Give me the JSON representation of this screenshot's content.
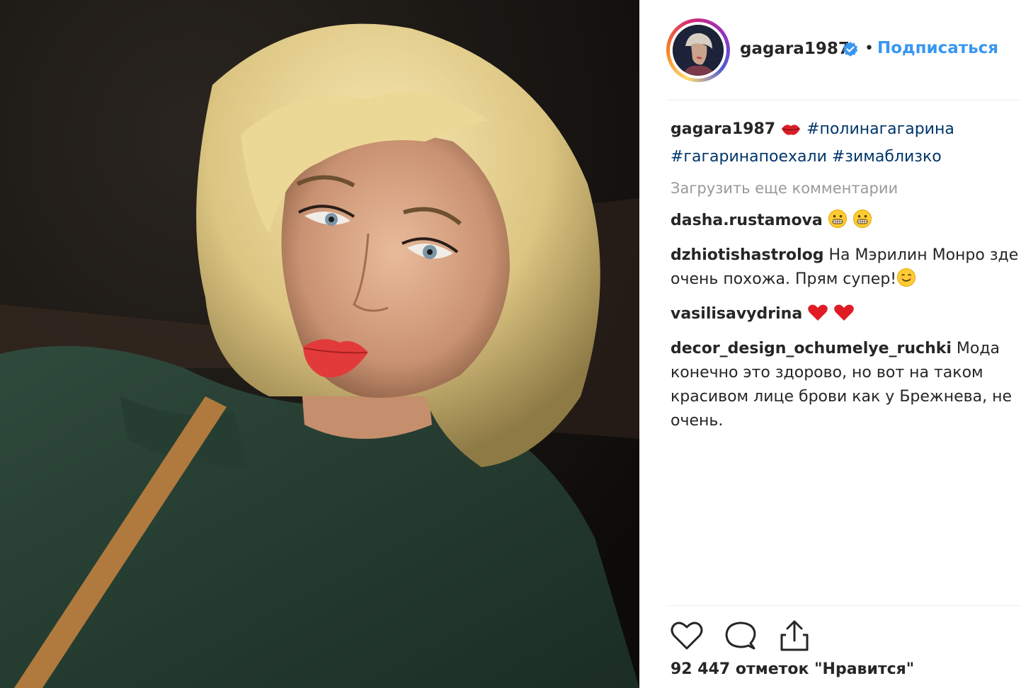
{
  "post": {
    "author": "gagara1987",
    "follow_label": "Подписаться",
    "separator": "•",
    "caption": {
      "user": "gagara1987",
      "emoji": "kiss-lips-icon",
      "text_line1": "#полинагагарина",
      "text_line2": "#гагаринапоехали #зимаблизко"
    },
    "load_more": "Загрузить еще комментарии",
    "comments": [
      {
        "user": "dasha.rustamova",
        "text": "",
        "emoji": "grinning-face-icon grinning-face-icon"
      },
      {
        "user": "dzhiotishastrolog",
        "text": "На Мэрилин Монро зде",
        "text2": "очень похожа. Прям супер!",
        "emoji": "smiling-face-icon"
      },
      {
        "user": "vasilisavydrina",
        "text": "",
        "emoji": "red-heart-icon red-heart-icon"
      },
      {
        "user": "decor_design_ochumelye_ruchki",
        "text": "Мода",
        "text2": "конечно это здорово, но вот на таком",
        "text3": "красивом лице брови как у Брежнева, не",
        "text4": "очень."
      }
    ],
    "likes": "92 447 отметок \"Нравится\""
  },
  "colors": {
    "link": "#3897f0",
    "hashtag": "#003569",
    "muted": "#999999",
    "heart": "#ed4956"
  }
}
